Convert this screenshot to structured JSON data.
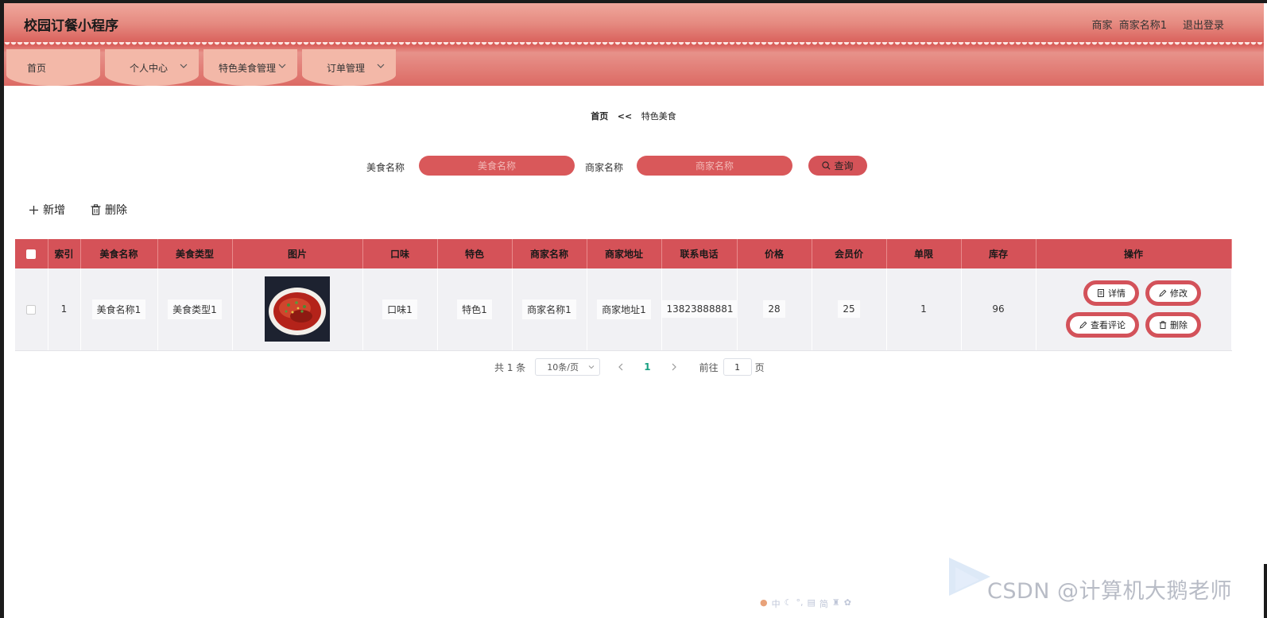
{
  "header": {
    "title": "校园订餐小程序",
    "role_label": "商家",
    "merchant_name": "商家名称1",
    "logout_label": "退出登录"
  },
  "nav": [
    {
      "label": "首页"
    },
    {
      "label": "个人中心"
    },
    {
      "label": "特色美食管理"
    },
    {
      "label": "订单管理"
    }
  ],
  "breadcrumb": {
    "home": "首页",
    "separator": "<<",
    "current": "特色美食"
  },
  "search": {
    "food_name_label": "美食名称",
    "food_name_placeholder": "美食名称",
    "merchant_name_label": "商家名称",
    "merchant_name_placeholder": "商家名称",
    "query_label": "查询"
  },
  "toolbar": {
    "add_label": "新增",
    "delete_label": "删除"
  },
  "table": {
    "headers": [
      "索引",
      "美食名称",
      "美食类型",
      "图片",
      "口味",
      "特色",
      "商家名称",
      "商家地址",
      "联系电话",
      "价格",
      "会员价",
      "单限",
      "库存",
      "操作"
    ],
    "rows": [
      {
        "index": "1",
        "food_name": "美食名称1",
        "food_type": "美食类型1",
        "taste": "口味1",
        "feature": "特色1",
        "merchant_name": "商家名称1",
        "merchant_address": "商家地址1",
        "phone": "13823888881",
        "price": "28",
        "member_price": "25",
        "limit": "1",
        "stock": "96"
      }
    ],
    "actions": {
      "detail": "详情",
      "edit": "修改",
      "comments": "查看评论",
      "delete": "删除"
    }
  },
  "pagination": {
    "total_label": "共 1 条",
    "page_size": "10条/页",
    "current_page": "1",
    "goto_label": "前往",
    "goto_value": "1",
    "goto_suffix": "页"
  },
  "watermark": {
    "text": "CSDN @计算机大鹅老师"
  },
  "ime_bar": {
    "chars": [
      "中",
      "简"
    ]
  },
  "colors": {
    "primary": "#d55258",
    "header_light": "#f0a79c",
    "nav_item": "#f3b8a8",
    "active_page": "#1aa082"
  }
}
